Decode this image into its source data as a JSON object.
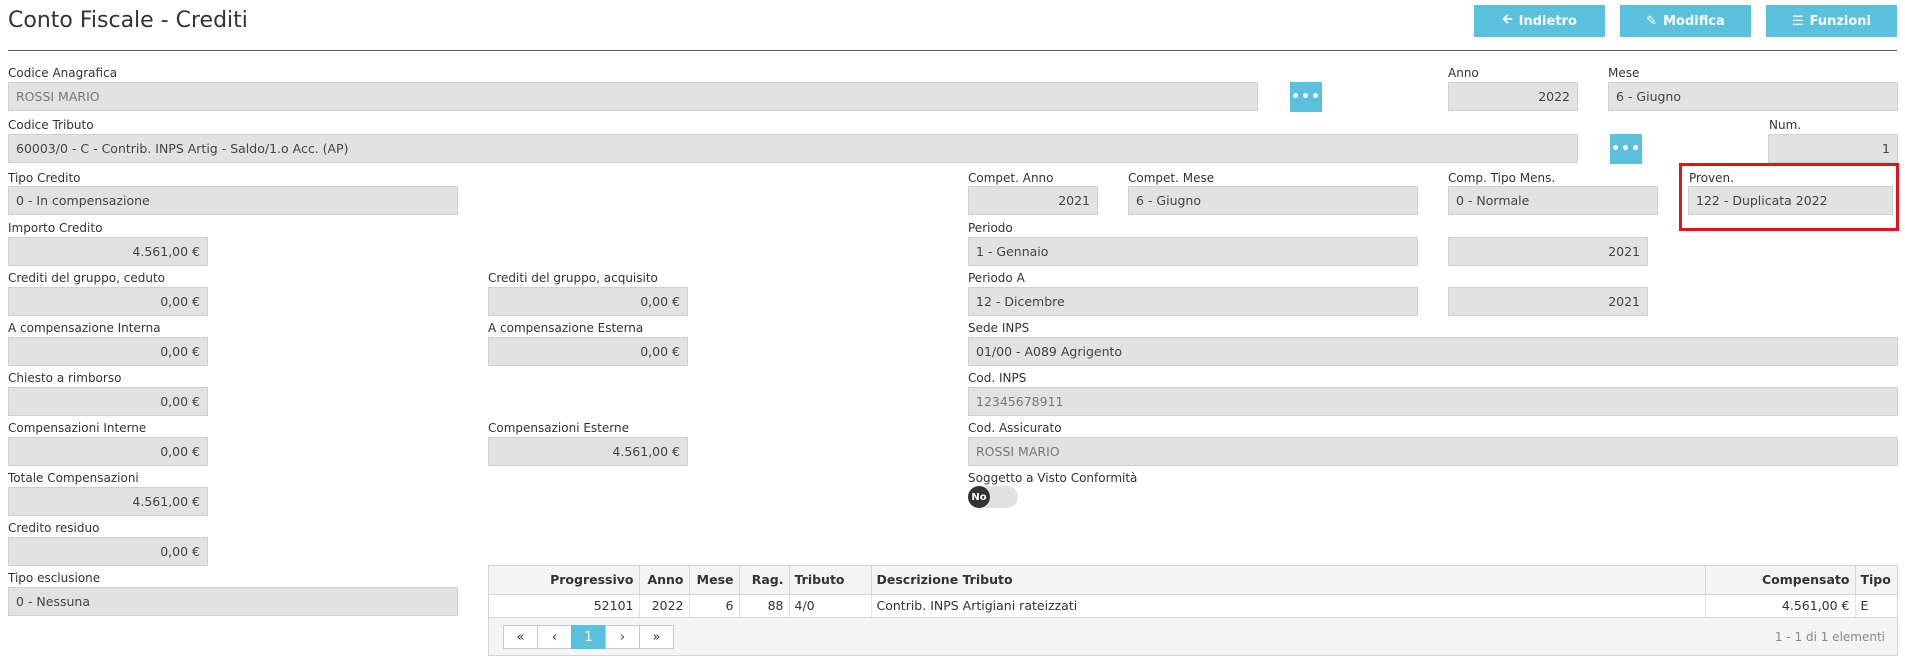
{
  "header": {
    "title": "Conto Fiscale - Crediti",
    "buttons": {
      "back": "Indietro",
      "edit": "Modifica",
      "functions": "Funzioni"
    }
  },
  "form": {
    "codice_anagrafica": {
      "label": "Codice Anagrafica",
      "value": "ROSSI MARIO"
    },
    "anno": {
      "label": "Anno",
      "value": "2022"
    },
    "mese": {
      "label": "Mese",
      "value": "6 - Giugno"
    },
    "codice_tributo": {
      "label": "Codice Tributo",
      "value": "60003/0 - C - Contrib. INPS Artig - Saldo/1.o Acc. (AP)"
    },
    "num": {
      "label": "Num.",
      "value": "1"
    },
    "tipo_credito": {
      "label": "Tipo Credito",
      "value": "0 - In compensazione"
    },
    "compet_anno": {
      "label": "Compet. Anno",
      "value": "2021"
    },
    "compet_mese": {
      "label": "Compet. Mese",
      "value": "6 - Giugno"
    },
    "comp_tipo_mens": {
      "label": "Comp. Tipo Mens.",
      "value": "0 - Normale"
    },
    "proven": {
      "label": "Proven.",
      "value": "122 - Duplicata 2022"
    },
    "importo_credito": {
      "label": "Importo Credito",
      "value": "4.561,00 €"
    },
    "periodo": {
      "label": "Periodo",
      "value": "1 - Gennaio",
      "year": "2021"
    },
    "crediti_gruppo_ceduto": {
      "label": "Crediti del gruppo, ceduto",
      "value": "0,00 €"
    },
    "crediti_gruppo_acquisito": {
      "label": "Crediti del gruppo, acquisito",
      "value": "0,00 €"
    },
    "periodo_a": {
      "label": "Periodo A",
      "value": "12 - Dicembre",
      "year": "2021"
    },
    "a_comp_interna": {
      "label": "A compensazione Interna",
      "value": "0,00 €"
    },
    "a_comp_esterna": {
      "label": "A compensazione Esterna",
      "value": "0,00 €"
    },
    "sede_inps": {
      "label": "Sede INPS",
      "value": "01/00 - A089 Agrigento"
    },
    "chiesto_rimborso": {
      "label": "Chiesto a rimborso",
      "value": "0,00 €"
    },
    "cod_inps": {
      "label": "Cod. INPS",
      "value": "12345678911"
    },
    "comp_interne": {
      "label": "Compensazioni Interne",
      "value": "0,00 €"
    },
    "comp_esterne": {
      "label": "Compensazioni Esterne",
      "value": "4.561,00 €"
    },
    "cod_assicurato": {
      "label": "Cod. Assicurato",
      "value": "ROSSI MARIO"
    },
    "totale_comp": {
      "label": "Totale Compensazioni",
      "value": "4.561,00 €"
    },
    "visto_conformita": {
      "label": "Soggetto a Visto Conformità",
      "toggle": "No"
    },
    "credito_residuo": {
      "label": "Credito residuo",
      "value": "0,00 €"
    },
    "tipo_esclusione": {
      "label": "Tipo esclusione",
      "value": "0 - Nessuna"
    }
  },
  "grid": {
    "columns": [
      "Progressivo",
      "Anno",
      "Mese",
      "Rag.",
      "Tributo",
      "Descrizione Tributo",
      "Compensato",
      "Tipo"
    ],
    "rows": [
      [
        "52101",
        "2022",
        "6",
        "88",
        "4/0",
        "Contrib. INPS Artigiani rateizzati",
        "4.561,00 €",
        "E"
      ]
    ],
    "pager": {
      "first": "«",
      "prev": "‹",
      "page": "1",
      "next": "›",
      "last": "»",
      "info": "1 - 1 di 1 elementi"
    }
  },
  "colors": {
    "accent": "#5bc0de",
    "highlight": "#e0141e",
    "field_bg": "#e2e2e2"
  }
}
